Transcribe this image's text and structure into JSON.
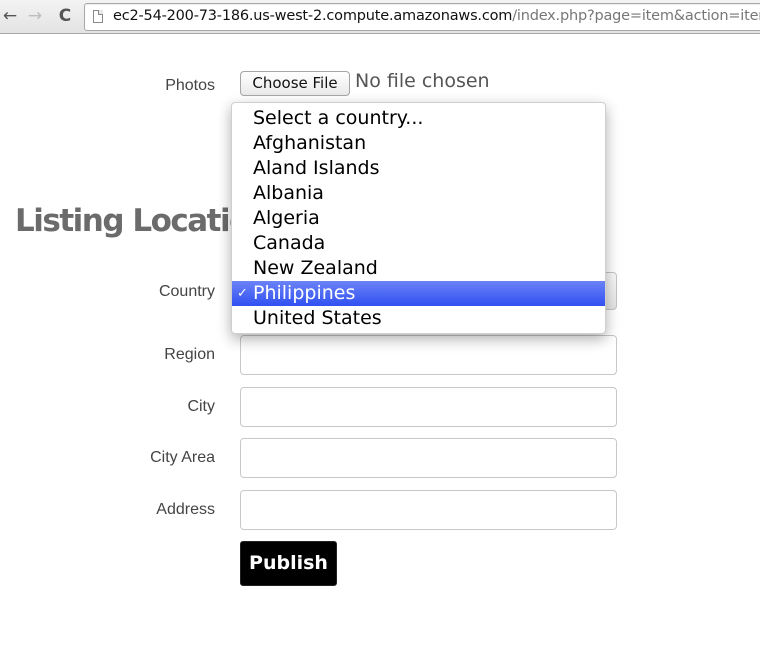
{
  "browser": {
    "nav": {
      "back_icon": "←",
      "forward_icon": "→",
      "reload_icon": "C"
    },
    "url_host": "ec2-54-200-73-186.us-west-2.compute.amazonaws.com",
    "url_path": "/index.php?page=item&action=item_add"
  },
  "form": {
    "photos": {
      "label": "Photos",
      "button_label": "Choose File",
      "status": "No file chosen"
    },
    "section_heading": "Listing Location",
    "country": {
      "label": "Country",
      "selected": "Philippines",
      "options": [
        "Select a country...",
        "Afghanistan",
        "Aland Islands",
        "Albania",
        "Algeria",
        "Canada",
        "New Zealand",
        "Philippines",
        "United States"
      ],
      "check_glyph": "✓"
    },
    "region": {
      "label": "Region",
      "value": ""
    },
    "city": {
      "label": "City",
      "value": ""
    },
    "city_area": {
      "label": "City Area",
      "value": ""
    },
    "address": {
      "label": "Address",
      "value": ""
    },
    "publish_label": "Publish"
  },
  "colors": {
    "selected_option": "#3d5cf4",
    "publish_bg": "#000000",
    "heading": "#6b6b6b"
  }
}
